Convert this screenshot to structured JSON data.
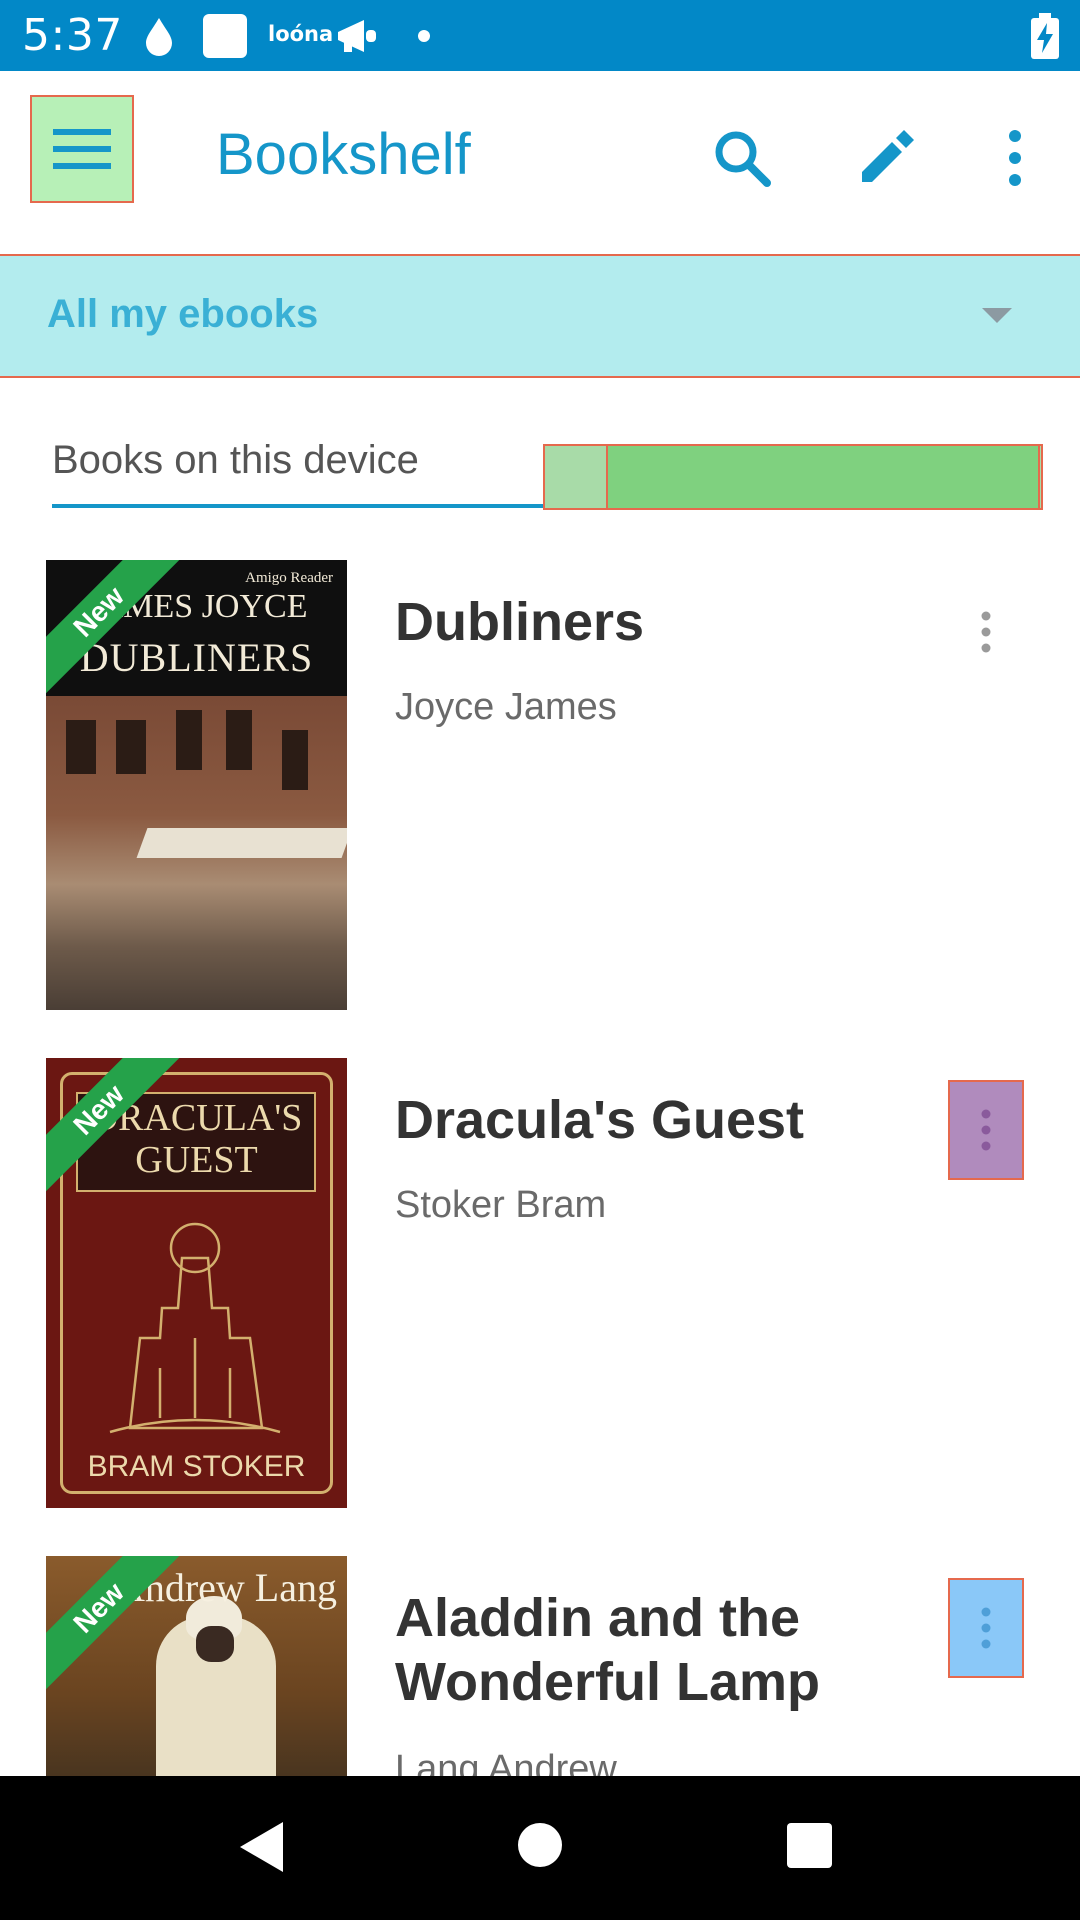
{
  "status_bar": {
    "time": "5:37",
    "brand_label": "loóna",
    "icons": [
      "water-drop-icon",
      "square-notification-icon",
      "megaphone-icon",
      "dot-icon",
      "battery-charging-icon"
    ]
  },
  "app_bar": {
    "title": "Bookshelf",
    "menu_icon": "hamburger-menu-icon",
    "search_icon": "search-icon",
    "edit_icon": "pencil-icon",
    "more_icon": "more-vert-icon"
  },
  "filter": {
    "selected": "All my ebooks"
  },
  "tabs": {
    "active": "Books on this device"
  },
  "books": [
    {
      "title": "Dubliners",
      "author": "Joyce James",
      "badge": "New",
      "cover": {
        "publisher": "Amigo Reader",
        "author_line": "JAMES JOYCE",
        "title_line": "DUBLINERS"
      }
    },
    {
      "title": "Dracula's Guest",
      "author": "Stoker Bram",
      "badge": "New",
      "cover": {
        "title_line1": "DRACULA'S",
        "title_line2": "GUEST",
        "author_line": "BRAM STOKER"
      }
    },
    {
      "title": "Aladdin and the Wonderful Lamp",
      "author": "Lang Andrew",
      "badge": "New",
      "cover": {
        "author_line": "Andrew Lang"
      }
    }
  ],
  "colors": {
    "status_bar": "#0288c7",
    "accent": "#1596c9",
    "new_badge": "#25a24a"
  }
}
